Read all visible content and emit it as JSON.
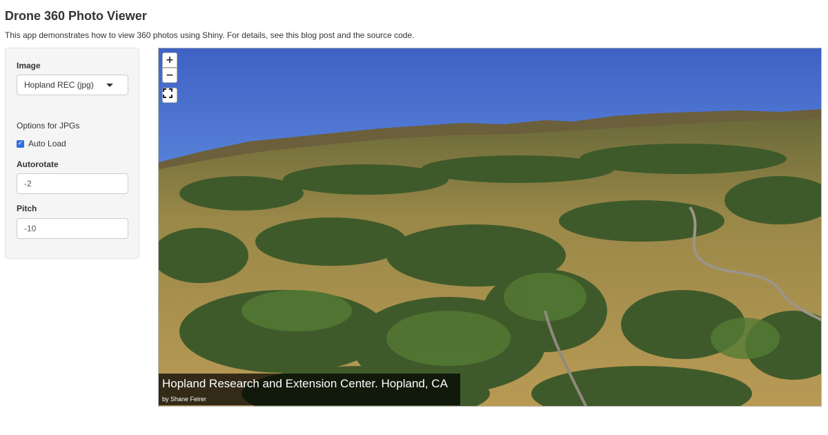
{
  "page": {
    "title": "Drone 360 Photo Viewer",
    "intro_prefix": "This app demonstrates how to view 360 photos using Shiny. For details, see ",
    "intro_link1": "this blog post",
    "intro_mid": " and ",
    "intro_link2": "the source code",
    "intro_suffix": "."
  },
  "sidebar": {
    "image_label": "Image",
    "image_selected": "Hopland REC (jpg)",
    "options_heading": "Options for JPGs",
    "autoload_label": "Auto Load",
    "autoload_checked": true,
    "autorotate_label": "Autorotate",
    "autorotate_value": "-2",
    "pitch_label": "Pitch",
    "pitch_value": "-10"
  },
  "viewer": {
    "zoom_in_label": "+",
    "zoom_out_label": "−",
    "caption_title": "Hopland Research and Extension Center. Hopland, CA",
    "caption_author": "by Shane Feirer"
  },
  "colors": {
    "sky": "#4468c8",
    "checkbox_accent": "#2f6fe0",
    "panel_bg": "#f5f5f5"
  },
  "icons": {
    "zoom_in": "plus-icon",
    "zoom_out": "minus-icon",
    "fullscreen": "fullscreen-icon",
    "dropdown": "caret-down-icon",
    "checkbox": "check-icon"
  }
}
